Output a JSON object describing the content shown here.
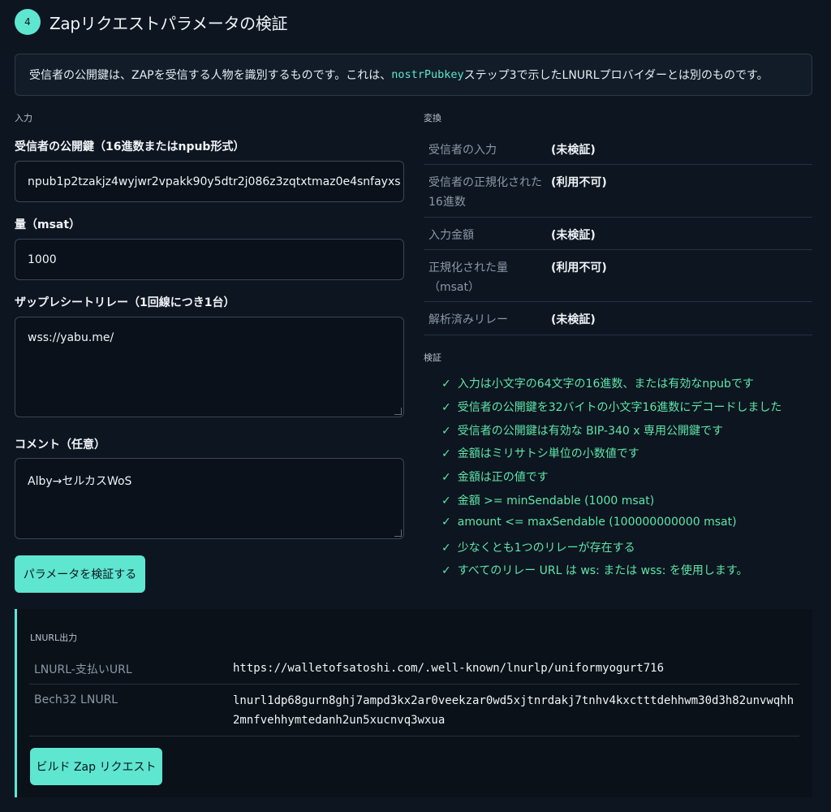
{
  "step": {
    "number": "4",
    "title": "Zapリクエストパラメータの検証"
  },
  "info": {
    "before": "受信者の公開鍵は、ZAPを受信する人物を識別するものです。これは、",
    "code": "nostrPubkey",
    "after": "ステップ3で示したLNURLプロバイダーとは別のものです。"
  },
  "input_section": {
    "label": "入力",
    "pubkey_label": "受信者の公開鍵（16進数またはnpub形式）",
    "pubkey_value": "npub1p2tzakjz4wyjwr2vpakk90y5dtr2j086z3zqtxtmaz0e4snfayxs",
    "amount_label": "量（msat）",
    "amount_value": "1000",
    "relays_label": "ザップレシートリレー（1回線につき1台）",
    "relays_value": "wss://yabu.me/",
    "comment_label": "コメント（任意）",
    "comment_value": "Alby→セルカスWoS",
    "validate_button": "パラメータを検証する"
  },
  "transform": {
    "label": "変換",
    "rows": [
      {
        "key": "受信者の入力",
        "value": "(未検証)"
      },
      {
        "key": "受信者の正規化された16進数",
        "value": "(利用不可)"
      },
      {
        "key": "入力金額",
        "value": "(未検証)"
      },
      {
        "key": "正規化された量（msat）",
        "value": "(利用不可)"
      },
      {
        "key": "解析済みリレー",
        "value": "(未検証)"
      }
    ]
  },
  "validation": {
    "label": "検証",
    "check_symbol": "✓",
    "items": [
      "入力は小文字の64文字の16進数、または有効なnpubです",
      "受信者の公開鍵を32バイトの小文字16進数にデコードしました",
      "受信者の公開鍵は有効な BIP-340 x 専用公開鍵です",
      "金額はミリサトシ単位の小数値です",
      "金額は正の値です",
      "金額 >= minSendable (1000 msat)",
      "amount <= maxSendable (100000000000 msat)",
      "少なくとも1つのリレーが存在する",
      "すべてのリレー URL は ws: または wss: を使用します。"
    ]
  },
  "output": {
    "label": "LNURL出力",
    "rows": [
      {
        "key": "LNURL-支払いURL",
        "value": "https://walletofsatoshi.com/.well-known/lnurlp/uniformyogurt716"
      },
      {
        "key": "Bech32 LNURL",
        "value": "lnurl1dp68gurn8ghj7ampd3kx2ar0veekzar0wd5xjtnrdakj7tnhv4kxctttdehhwm30d3h82unvwqhh2mnfvehhymtedanh2un5xucnvq3wxua"
      }
    ],
    "build_button": "ビルド Zap リクエスト"
  },
  "colors": {
    "accent": "#5ee6d0",
    "success": "#5ee6a8",
    "background": "#0d1520"
  }
}
